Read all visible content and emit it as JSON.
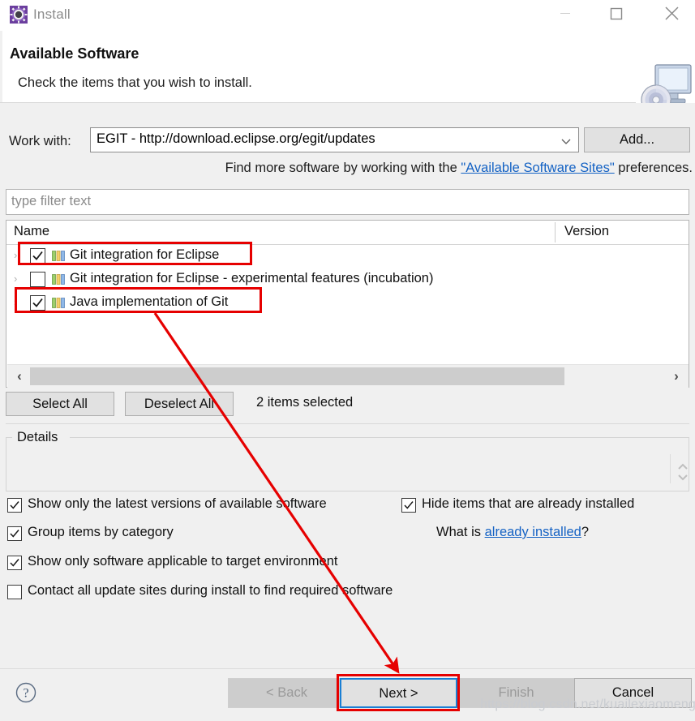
{
  "window": {
    "title": "Install",
    "icon": "eclipse-install-gear-icon",
    "controls": {
      "minimize": "minimize-icon",
      "maximize": "maximize-icon",
      "close": "close-icon"
    }
  },
  "header": {
    "title": "Available Software",
    "subtitle": "Check the items that you wish to install.",
    "image": "monitor-with-disc-icon"
  },
  "work_with": {
    "label": "Work with:",
    "value": "EGIT - http://download.eclipse.org/egit/updates",
    "dropdown_icon": "chevron-down-icon",
    "add_button": "Add..."
  },
  "find_more": {
    "prefix": "Find more software by working with the ",
    "link": "\"Available Software Sites\"",
    "suffix": " preferences."
  },
  "filter": {
    "placeholder": "type filter text",
    "value": ""
  },
  "tree": {
    "columns": [
      "Name",
      "Version"
    ],
    "rows": [
      {
        "name": "Git integration for Eclipse",
        "version": "",
        "checked": true,
        "expandable": true,
        "highlighted": true,
        "icon": "feature-bars-icon"
      },
      {
        "name": "Git integration for Eclipse - experimental features  (incubation)",
        "version": "",
        "checked": false,
        "expandable": true,
        "highlighted": false,
        "icon": "feature-bars-icon"
      },
      {
        "name": "Java implementation of Git",
        "version": "",
        "checked": true,
        "expandable": true,
        "highlighted": true,
        "icon": "feature-bars-icon"
      }
    ],
    "hscroll": {
      "left_arrow": "chevron-left-icon",
      "right_arrow": "chevron-right-icon"
    }
  },
  "selection_bar": {
    "select_all": "Select All",
    "deselect_all": "Deselect All",
    "status": "2 items selected"
  },
  "details": {
    "legend": "Details",
    "content": "",
    "scroll_up_icon": "chevron-up-icon",
    "scroll_down_icon": "chevron-down-icon"
  },
  "options": [
    {
      "label": "Show only the latest versions of available software",
      "checked": true
    },
    {
      "label": "Group items by category",
      "checked": true
    },
    {
      "label": "Show only software applicable to target environment",
      "checked": true
    },
    {
      "label": "Contact all update sites during install to find required software",
      "checked": false
    },
    {
      "label": "Hide items that are already installed",
      "checked": true
    }
  ],
  "what_is": {
    "prefix": "What is ",
    "link": "already installed",
    "suffix": "?"
  },
  "footer": {
    "help_icon": "help-question-icon",
    "back": "< Back",
    "next": "Next >",
    "finish": "Finish",
    "cancel": "Cancel"
  },
  "annotations": {
    "watermark": "https://blog.csdn.net/kuailexiaomeng",
    "highlight_color": "#e60000",
    "arrow_color": "#e60000",
    "focus_color": "#1a7fd4"
  }
}
